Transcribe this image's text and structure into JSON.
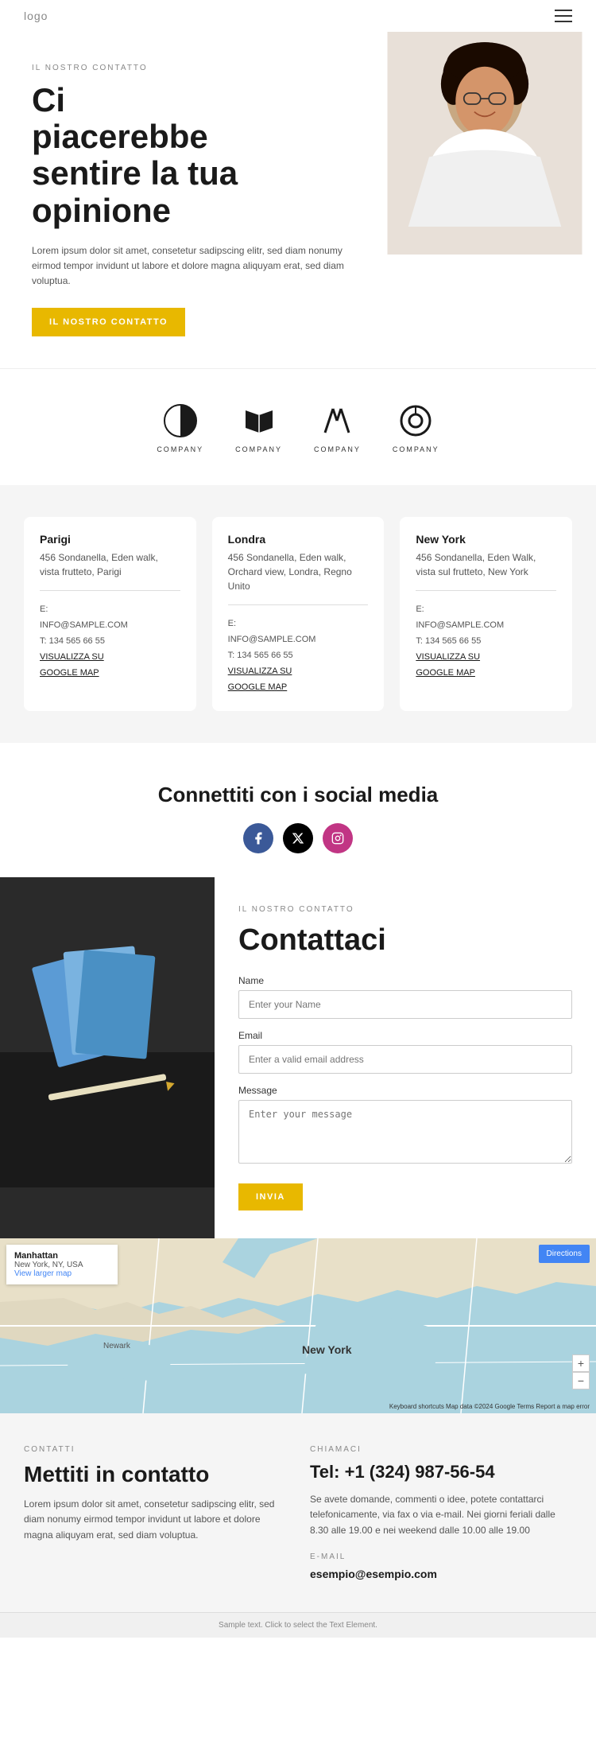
{
  "header": {
    "logo": "logo",
    "menu_icon": "☰"
  },
  "hero": {
    "section_label": "IL NOSTRO CONTATTO",
    "title_line1": "Ci",
    "title_line2": "piacerebbe",
    "title_line3": "sentire la tua",
    "title_line4": "opinione",
    "description": "Lorem ipsum dolor sit amet, consetetur sadipscing elitr, sed diam nonumy eirmod tempor invidunt ut labore et dolore magna aliquyam erat, sed diam voluptua.",
    "button_label": "IL NOSTRO CONTATTO"
  },
  "logos": [
    {
      "name": "COMPANY",
      "shape": "circle-half"
    },
    {
      "name": "COMPANY",
      "shape": "book"
    },
    {
      "name": "COMPANY",
      "shape": "lines"
    },
    {
      "name": "COMPANY",
      "shape": "ring"
    }
  ],
  "offices": [
    {
      "city": "Parigi",
      "address": "456 Sondanella, Eden walk, vista frutteto, Parigi",
      "email_label": "E:",
      "email": "INFO@SAMPLE.COM",
      "phone_label": "T:",
      "phone": "134 565 66 55",
      "map_link": "VISUALIZZA SU\nGOOGLE MAP"
    },
    {
      "city": "Londra",
      "address": "456 Sondanella, Eden walk, Orchard view, Londra, Regno Unito",
      "email_label": "E:",
      "email": "INFO@SAMPLE.COM",
      "phone_label": "T:",
      "phone": "134 565 66 55",
      "map_link": "VISUALIZZA SU\nGOOGLE MAP"
    },
    {
      "city": "New York",
      "address": "456 Sondanella, Eden Walk, vista sul frutteto, New York",
      "email_label": "E:",
      "email": "INFO@SAMPLE.COM",
      "phone_label": "T:",
      "phone": "134 565 66 55",
      "map_link": "VISUALIZZA SU\nGOOGLE MAP"
    }
  ],
  "social": {
    "title": "Connettiti con i social media",
    "icons": [
      "f",
      "𝕏",
      "📷"
    ]
  },
  "contact_form": {
    "section_label": "IL NOSTRO CONTATTO",
    "title": "Contattaci",
    "name_label": "Name",
    "name_placeholder": "Enter your Name",
    "email_label": "Email",
    "email_placeholder": "Enter a valid email address",
    "message_label": "Message",
    "message_placeholder": "Enter your message",
    "button_label": "INVIA"
  },
  "map": {
    "location_title": "Manhattan",
    "location_sub": "New York, NY, USA",
    "view_larger": "View larger map",
    "directions_label": "Directions",
    "zoom_in": "+",
    "zoom_out": "−",
    "credits": "Keyboard shortcuts  Map data ©2024 Google  Terms  Report a map error"
  },
  "bottom": {
    "left": {
      "section_label": "CONTATTI",
      "title": "Mettiti in contatto",
      "description": "Lorem ipsum dolor sit amet, consetetur sadipscing elitr, sed diam nonumy eirmod tempor invidunt ut labore et dolore magna aliquyam erat, sed diam voluptua."
    },
    "right": {
      "section_label": "CHIAMACI",
      "phone": "Tel: +1 (324) 987-56-54",
      "note": "Se avete domande, commenti o idee, potete contattarci telefonicamente, via fax o via e-mail. Nei giorni feriali dalle 8.30 alle 19.00 e nei weekend dalle 10.00 alle 19.00",
      "email_label": "E-MAIL",
      "email": "esempio@esempio.com"
    }
  },
  "footer": {
    "text": "Sample text. Click to select the Text Element."
  }
}
